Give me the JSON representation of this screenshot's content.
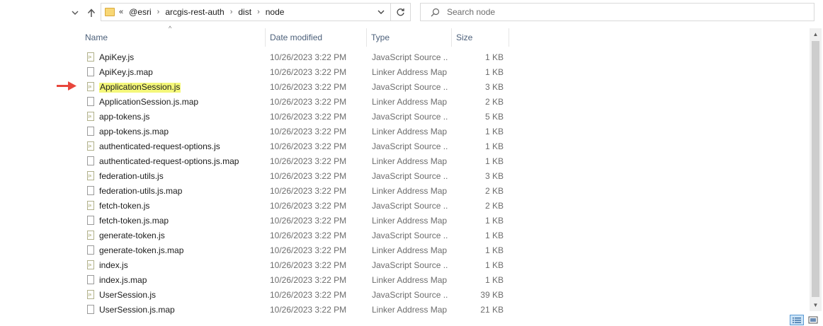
{
  "address_bar": {
    "overflow": "«",
    "breadcrumbs": [
      "@esri",
      "arcgis-rest-auth",
      "dist",
      "node"
    ]
  },
  "search": {
    "placeholder": "Search node"
  },
  "columns": {
    "name": "Name",
    "date": "Date modified",
    "type": "Type",
    "size": "Size"
  },
  "files": [
    {
      "name": "ApiKey.js",
      "date": "10/26/2023 3:22 PM",
      "type": "JavaScript Source ...",
      "size": "1 KB",
      "kind": "js"
    },
    {
      "name": "ApiKey.js.map",
      "date": "10/26/2023 3:22 PM",
      "type": "Linker Address Map",
      "size": "1 KB",
      "kind": "map"
    },
    {
      "name": "ApplicationSession.js",
      "date": "10/26/2023 3:22 PM",
      "type": "JavaScript Source ...",
      "size": "3 KB",
      "kind": "js",
      "highlight": true
    },
    {
      "name": "ApplicationSession.js.map",
      "date": "10/26/2023 3:22 PM",
      "type": "Linker Address Map",
      "size": "2 KB",
      "kind": "map"
    },
    {
      "name": "app-tokens.js",
      "date": "10/26/2023 3:22 PM",
      "type": "JavaScript Source ...",
      "size": "5 KB",
      "kind": "js"
    },
    {
      "name": "app-tokens.js.map",
      "date": "10/26/2023 3:22 PM",
      "type": "Linker Address Map",
      "size": "1 KB",
      "kind": "map"
    },
    {
      "name": "authenticated-request-options.js",
      "date": "10/26/2023 3:22 PM",
      "type": "JavaScript Source ...",
      "size": "1 KB",
      "kind": "js"
    },
    {
      "name": "authenticated-request-options.js.map",
      "date": "10/26/2023 3:22 PM",
      "type": "Linker Address Map",
      "size": "1 KB",
      "kind": "map"
    },
    {
      "name": "federation-utils.js",
      "date": "10/26/2023 3:22 PM",
      "type": "JavaScript Source ...",
      "size": "3 KB",
      "kind": "js"
    },
    {
      "name": "federation-utils.js.map",
      "date": "10/26/2023 3:22 PM",
      "type": "Linker Address Map",
      "size": "2 KB",
      "kind": "map"
    },
    {
      "name": "fetch-token.js",
      "date": "10/26/2023 3:22 PM",
      "type": "JavaScript Source ...",
      "size": "2 KB",
      "kind": "js"
    },
    {
      "name": "fetch-token.js.map",
      "date": "10/26/2023 3:22 PM",
      "type": "Linker Address Map",
      "size": "1 KB",
      "kind": "map"
    },
    {
      "name": "generate-token.js",
      "date": "10/26/2023 3:22 PM",
      "type": "JavaScript Source ...",
      "size": "1 KB",
      "kind": "js"
    },
    {
      "name": "generate-token.js.map",
      "date": "10/26/2023 3:22 PM",
      "type": "Linker Address Map",
      "size": "1 KB",
      "kind": "map"
    },
    {
      "name": "index.js",
      "date": "10/26/2023 3:22 PM",
      "type": "JavaScript Source ...",
      "size": "1 KB",
      "kind": "js"
    },
    {
      "name": "index.js.map",
      "date": "10/26/2023 3:22 PM",
      "type": "Linker Address Map",
      "size": "1 KB",
      "kind": "map"
    },
    {
      "name": "UserSession.js",
      "date": "10/26/2023 3:22 PM",
      "type": "JavaScript Source ...",
      "size": "39 KB",
      "kind": "js"
    },
    {
      "name": "UserSession.js.map",
      "date": "10/26/2023 3:22 PM",
      "type": "Linker Address Map",
      "size": "21 KB",
      "kind": "map"
    }
  ],
  "colors": {
    "highlight": "#f4f77a",
    "arrow": "#e8463c",
    "header_text": "#4c607a",
    "folder": "#f8d775"
  },
  "icons": {
    "expand": "chevron-down-icon",
    "up": "arrow-up-icon",
    "dropdown": "chevron-down-icon",
    "refresh": "refresh-icon",
    "search": "search-icon",
    "js_file": "js-file-icon",
    "map_file": "file-icon",
    "annotation": "red-arrow-icon"
  }
}
